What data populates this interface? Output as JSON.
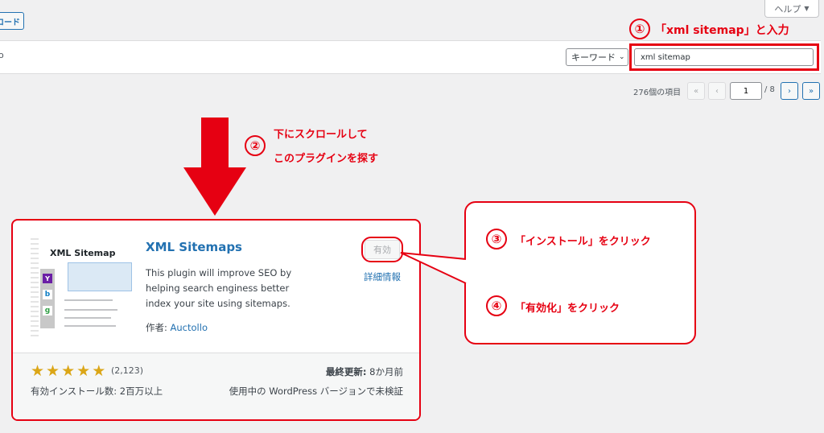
{
  "header": {
    "help_label": "ヘルプ",
    "upload_label": "ロード"
  },
  "filter": {
    "left_fragment": "o",
    "select_value": "キーワード",
    "search_value": "xml sitemap"
  },
  "pagination": {
    "count_text": "276個の項目",
    "first": "«",
    "prev": "‹",
    "current": "1",
    "total": "/ 8",
    "next": "›",
    "last": "»"
  },
  "annotations": {
    "step1_num": "①",
    "step1_text": "「xml sitemap」と入力",
    "step2_num": "②",
    "step2_line1": "下にスクロールして",
    "step2_line2": "このプラグインを探す",
    "step3_num": "③",
    "step3_text": "「インストール」をクリック",
    "step4_num": "④",
    "step4_text": "「有効化」をクリック"
  },
  "plugin": {
    "thumb_title": "XML Sitemap",
    "name": "XML Sitemaps",
    "description": "This plugin will improve SEO by helping search enginess better index your site using sitemaps.",
    "author_label": "作者: ",
    "author_name": "Auctollo",
    "action_label": "有効",
    "details_label": "詳細情報",
    "rating": 5,
    "rating_count": "(2,123)",
    "installs": "有効インストール数: 2百万以上",
    "updated_label": "最終更新:",
    "updated_value": "8か月前",
    "compat": "使用中の WordPress バージョンで未検証"
  },
  "colors": {
    "annotation_red": "#e60012",
    "link_blue": "#2271b1",
    "star_gold": "#dba617"
  }
}
